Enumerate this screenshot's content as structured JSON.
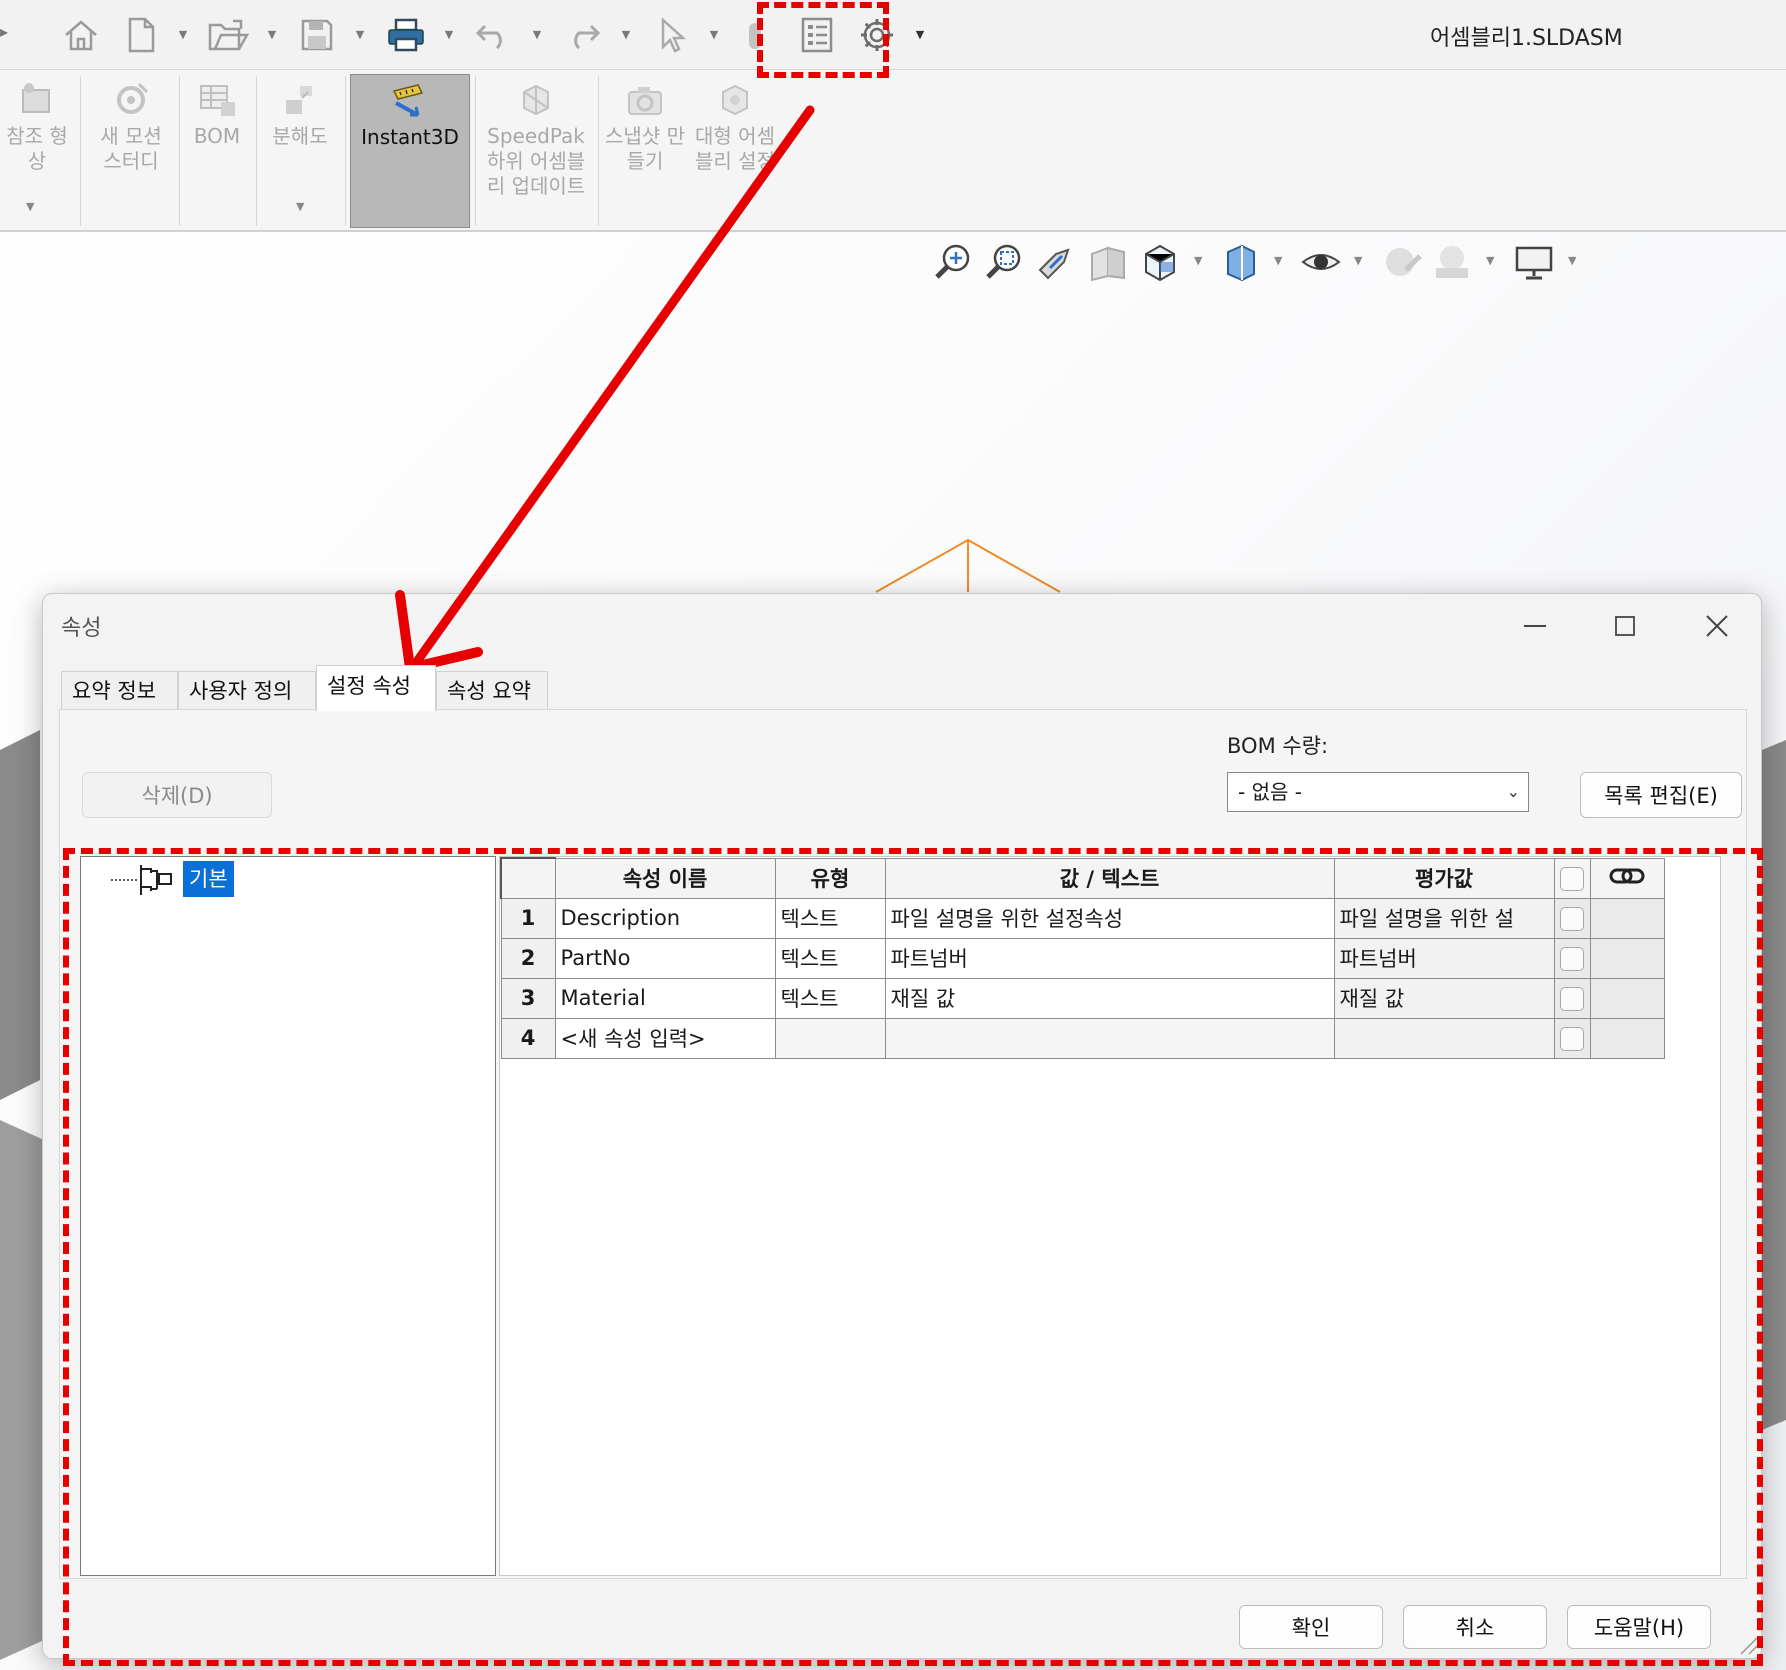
{
  "window": {
    "document_title": "어셈블리1.SLDASM"
  },
  "ribbon": {
    "items": [
      {
        "label": "참조 형상",
        "icon": "reference-geometry-icon",
        "enabled": false
      },
      {
        "label": "새 모션 스터디",
        "icon": "motion-study-icon",
        "enabled": false
      },
      {
        "label": "BOM",
        "icon": "bom-icon",
        "enabled": false
      },
      {
        "label": "분해도",
        "icon": "exploded-view-icon",
        "enabled": false
      },
      {
        "label": "Instant3D",
        "icon": "instant3d-icon",
        "enabled": true,
        "active": true
      },
      {
        "label": "SpeedPak 하위 어셈블리 업데이트",
        "icon": "speedpak-icon",
        "enabled": false
      },
      {
        "label": "스냅샷 만들기",
        "icon": "snapshot-icon",
        "enabled": false
      },
      {
        "label": "대형 어셈블리 설정",
        "icon": "large-assembly-icon",
        "enabled": false
      }
    ]
  },
  "dialog": {
    "title": "속성",
    "tabs": [
      {
        "label": "요약 정보",
        "active": false
      },
      {
        "label": "사용자 정의",
        "active": false
      },
      {
        "label": "설정 속성",
        "active": true
      },
      {
        "label": "속성 요약",
        "active": false
      }
    ],
    "delete_button": "삭제(D)",
    "bom_quantity_label": "BOM 수량:",
    "bom_quantity_value": "- 없음 -",
    "edit_list_button": "목록 편집(E)",
    "tree": {
      "selected_label": "기본"
    },
    "grid": {
      "headers": {
        "name": "속성 이름",
        "type": "유형",
        "value": "값 / 텍스트",
        "evaluated": "평가값"
      },
      "rows": [
        {
          "num": "1",
          "name": "Description",
          "type": "텍스트",
          "value": "파일 설명을 위한 설정속성",
          "evaluated": "파일 설명을 위한 설"
        },
        {
          "num": "2",
          "name": "PartNo",
          "type": "텍스트",
          "value": "파트넘버",
          "evaluated": "파트넘버"
        },
        {
          "num": "3",
          "name": "Material",
          "type": "텍스트",
          "value": "재질 값",
          "evaluated": "재질 값"
        },
        {
          "num": "4",
          "name": "<새 속성 입력>",
          "type": "",
          "value": "",
          "evaluated": ""
        }
      ]
    },
    "ok_button": "확인",
    "cancel_button": "취소",
    "help_button": "도움말(H)"
  },
  "colors": {
    "annotation_red": "#e60000",
    "selection_blue": "#0a6fd6",
    "cad_orange": "#f08a24"
  }
}
